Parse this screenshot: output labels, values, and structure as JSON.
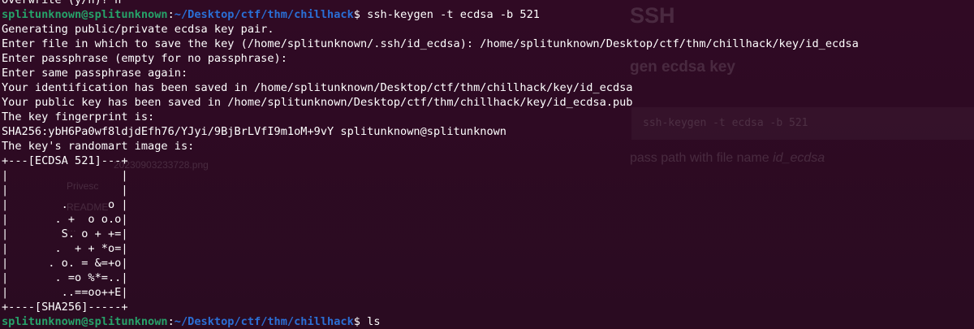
{
  "background_docs": {
    "heading": "SSH",
    "subheading": "gen ecdsa key",
    "code": "ssh-keygen -t ecdsa -b 521",
    "text_prefix": "pass path with file name ",
    "text_em": "id_ecdsa",
    "sidebar": [
      "20230903233728.png",
      "Privesc",
      "README",
      "…"
    ]
  },
  "terminal": {
    "user_host": "splitunknown@splitunknown",
    "colors": {
      "user": "#26a269",
      "path": "#2a6fd6",
      "text": "#ffffff",
      "background": "#300a24"
    },
    "lines": [
      {
        "kind": "text",
        "text": "Overwrite (y/n)? n"
      },
      {
        "kind": "prompt",
        "user": "splitunknown@splitunknown",
        "path": "~/Desktop/ctf/thm/chillhack",
        "command": "ssh-keygen -t ecdsa -b 521"
      },
      {
        "kind": "text",
        "text": "Generating public/private ecdsa key pair."
      },
      {
        "kind": "text",
        "text": "Enter file in which to save the key (/home/splitunknown/.ssh/id_ecdsa): /home/splitunknown/Desktop/ctf/thm/chillhack/key/id_ecdsa"
      },
      {
        "kind": "text",
        "text": "Enter passphrase (empty for no passphrase):"
      },
      {
        "kind": "text",
        "text": "Enter same passphrase again:"
      },
      {
        "kind": "text",
        "text": "Your identification has been saved in /home/splitunknown/Desktop/ctf/thm/chillhack/key/id_ecdsa"
      },
      {
        "kind": "text",
        "text": "Your public key has been saved in /home/splitunknown/Desktop/ctf/thm/chillhack/key/id_ecdsa.pub"
      },
      {
        "kind": "text",
        "text": "The key fingerprint is:"
      },
      {
        "kind": "text",
        "text": "SHA256:ybH6Pa0wf8ldjdEfh76/YJyi/9BjBrLVfI9m1oM+9vY splitunknown@splitunknown"
      },
      {
        "kind": "text",
        "text": "The key's randomart image is:"
      },
      {
        "kind": "text",
        "text": "+---[ECDSA 521]---+"
      },
      {
        "kind": "text",
        "text": "|                 |"
      },
      {
        "kind": "text",
        "text": "|                 |"
      },
      {
        "kind": "text",
        "text": "|        .      o |"
      },
      {
        "kind": "text",
        "text": "|       . +  o o.o|"
      },
      {
        "kind": "text",
        "text": "|        S. o + +=|"
      },
      {
        "kind": "text",
        "text": "|       .  + + *o=|"
      },
      {
        "kind": "text",
        "text": "|      . o. = &=+o|"
      },
      {
        "kind": "text",
        "text": "|       . =o %*=..|"
      },
      {
        "kind": "text",
        "text": "|        ..==oo++E|"
      },
      {
        "kind": "text",
        "text": "+----[SHA256]-----+"
      },
      {
        "kind": "prompt",
        "user": "splitunknown@splitunknown",
        "path": "~/Desktop/ctf/thm/chillhack",
        "command": "ls"
      }
    ]
  }
}
